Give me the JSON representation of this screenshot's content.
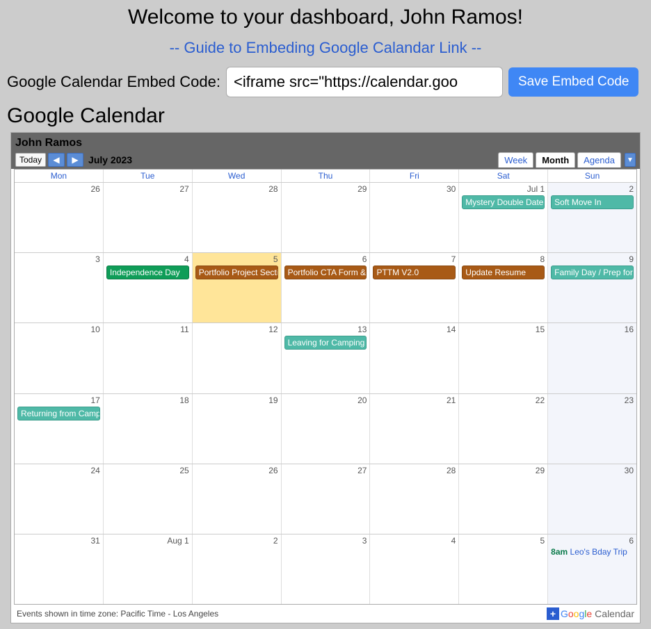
{
  "header": {
    "welcome": "Welcome to your dashboard, John Ramos!",
    "guide_link": "-- Guide to Embeding Google Calandar Link --",
    "embed_label": "Google Calendar Embed Code:",
    "embed_value": "<iframe src=\"https://calendar.goo",
    "save_label": "Save Embed Code",
    "section_heading": "Google Calendar"
  },
  "calendar": {
    "owner": "John Ramos",
    "today_label": "Today",
    "period": "July 2023",
    "views": {
      "week": "Week",
      "month": "Month",
      "agenda": "Agenda"
    },
    "active_view": "Month",
    "dow": [
      "Mon",
      "Tue",
      "Wed",
      "Thu",
      "Fri",
      "Sat",
      "Sun"
    ],
    "weeks": [
      {
        "days": [
          {
            "num": "26",
            "other": true
          },
          {
            "num": "27",
            "other": true
          },
          {
            "num": "28",
            "other": true
          },
          {
            "num": "29",
            "other": true
          },
          {
            "num": "30",
            "other": true
          },
          {
            "num": "Jul 1",
            "events": [
              {
                "label": "Mystery Double Date",
                "cls": "ev-teal"
              }
            ]
          },
          {
            "num": "2",
            "sunday": true,
            "events": [
              {
                "label": "Soft Move In",
                "cls": "ev-teal"
              }
            ]
          }
        ]
      },
      {
        "days": [
          {
            "num": "3"
          },
          {
            "num": "4",
            "events": [
              {
                "label": "Independence Day",
                "cls": "ev-green"
              }
            ]
          },
          {
            "num": "5",
            "today": true,
            "events": [
              {
                "label": "Portfolio Project Section",
                "cls": "ev-brown"
              }
            ]
          },
          {
            "num": "6",
            "events": [
              {
                "label": "Portfolio CTA Form & De",
                "cls": "ev-brown"
              }
            ]
          },
          {
            "num": "7",
            "events": [
              {
                "label": "PTTM V2.0",
                "cls": "ev-brown"
              }
            ]
          },
          {
            "num": "8",
            "events": [
              {
                "label": "Update Resume",
                "cls": "ev-brown"
              }
            ]
          },
          {
            "num": "9",
            "sunday": true,
            "events": [
              {
                "label": "Family Day / Prep for ca",
                "cls": "ev-teal"
              }
            ]
          }
        ]
      },
      {
        "days": [
          {
            "num": "10"
          },
          {
            "num": "11"
          },
          {
            "num": "12"
          },
          {
            "num": "13",
            "events": [
              {
                "label": "Leaving for Camping",
                "cls": "ev-teal"
              }
            ]
          },
          {
            "num": "14"
          },
          {
            "num": "15"
          },
          {
            "num": "16",
            "sunday": true
          }
        ]
      },
      {
        "days": [
          {
            "num": "17",
            "events": [
              {
                "label": "Returning from Camping",
                "cls": "ev-teal"
              }
            ]
          },
          {
            "num": "18"
          },
          {
            "num": "19"
          },
          {
            "num": "20"
          },
          {
            "num": "21"
          },
          {
            "num": "22"
          },
          {
            "num": "23",
            "sunday": true
          }
        ]
      },
      {
        "days": [
          {
            "num": "24"
          },
          {
            "num": "25"
          },
          {
            "num": "26"
          },
          {
            "num": "27"
          },
          {
            "num": "28"
          },
          {
            "num": "29"
          },
          {
            "num": "30",
            "sunday": true
          }
        ]
      },
      {
        "days": [
          {
            "num": "31"
          },
          {
            "num": "Aug 1",
            "other": true
          },
          {
            "num": "2",
            "other": true
          },
          {
            "num": "3",
            "other": true
          },
          {
            "num": "4",
            "other": true
          },
          {
            "num": "5",
            "other": true
          },
          {
            "num": "6",
            "other": true,
            "sunday": true,
            "timed": {
              "time": "8am",
              "label": "Leo's Bday Trip"
            }
          }
        ]
      }
    ],
    "footer_tz": "Events shown in time zone: Pacific Time - Los Angeles",
    "badge": "Calendar"
  }
}
